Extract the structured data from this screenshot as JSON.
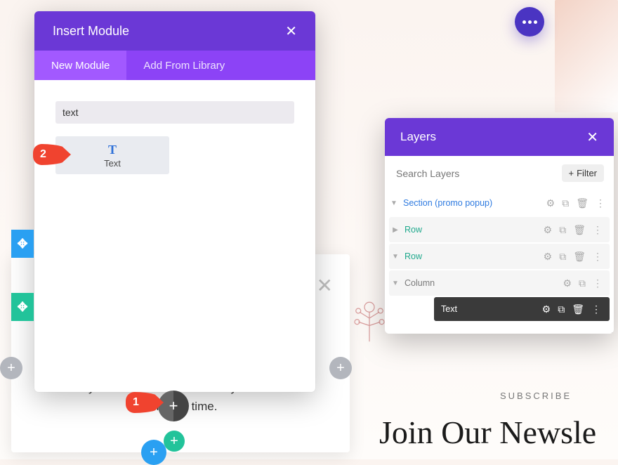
{
  "dots_button": {
    "name": "page-options"
  },
  "insert_module": {
    "title": "Insert Module",
    "tabs": {
      "new": "New Module",
      "library": "Add From Library"
    },
    "search_value": "text",
    "result": {
      "label": "Text",
      "icon_name": "text-module-icon"
    }
  },
  "callouts": {
    "one": "1",
    "two": "2"
  },
  "promo": {
    "text_line": "when you ……… This offer is only available for a limited time."
  },
  "layers": {
    "title": "Layers",
    "search_placeholder": "Search Layers",
    "filter_label": "Filter",
    "items": [
      {
        "label": "Section (promo popup)",
        "kind": "section"
      },
      {
        "label": "Row",
        "kind": "row"
      },
      {
        "label": "Row",
        "kind": "row"
      },
      {
        "label": "Column",
        "kind": "column"
      },
      {
        "label": "Text",
        "kind": "module"
      }
    ]
  },
  "subscribe": {
    "kicker": "SUBSCRIBE",
    "headline": "Join Our Newsle"
  }
}
